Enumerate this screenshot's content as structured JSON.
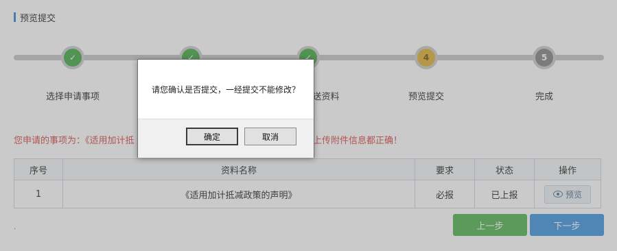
{
  "header": {
    "title": "预览提交"
  },
  "steps": [
    {
      "label": "选择申请事项",
      "number": "",
      "status": "done"
    },
    {
      "label": "",
      "number": "",
      "status": "done"
    },
    {
      "label": "送资料",
      "number": "",
      "status": "done"
    },
    {
      "label": "预览提交",
      "number": "4",
      "status": "current"
    },
    {
      "label": "完成",
      "number": "5",
      "status": "todo"
    }
  ],
  "notice": {
    "left_text": "您申请的事项为：《适用加计抵",
    "right_text": "上传附件信息都正确！"
  },
  "table": {
    "headers": [
      "序号",
      "资料名称",
      "要求",
      "状态",
      "操作"
    ],
    "rows": [
      {
        "index": "1",
        "name": "《适用加计抵减政策的声明》",
        "requirement": "必报",
        "status": "已上报",
        "action": "预览"
      }
    ]
  },
  "footer": {
    "dot": ".",
    "prev_label": "上一步",
    "next_label": "下一步"
  },
  "dialog": {
    "message": "请您确认是否提交，一经提交不能修改？",
    "ok_label": "确定",
    "cancel_label": "取消"
  },
  "colors": {
    "done": "#4caf50",
    "current": "#e0b53f",
    "todo": "#8c8c8c",
    "notice": "#d9534f",
    "prev_button": "#5cb85c",
    "next_button": "#4a9be0"
  }
}
